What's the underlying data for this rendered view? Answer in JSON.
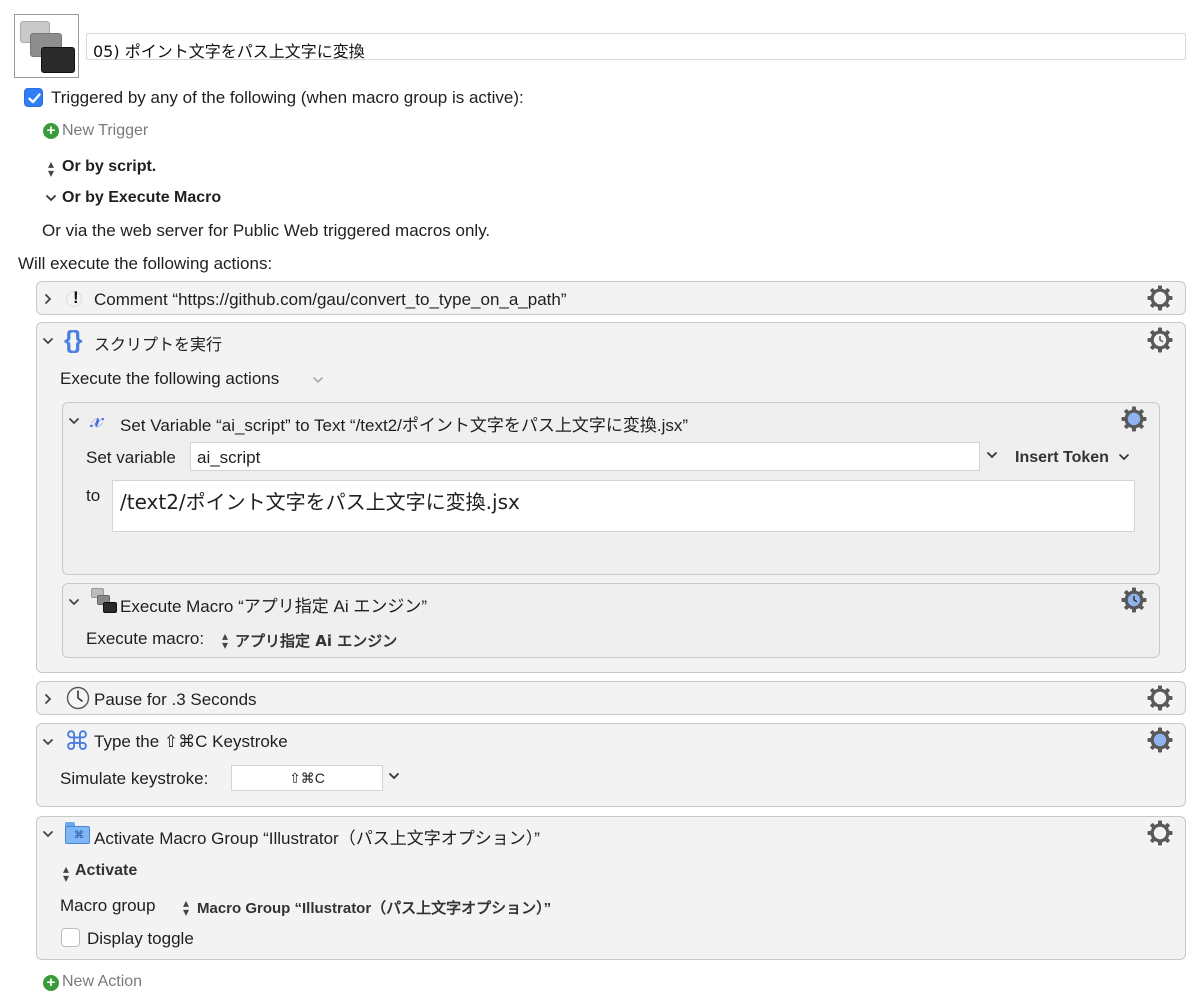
{
  "macro": {
    "name": "05) ポイント文字をパス上文字に変換"
  },
  "triggers": {
    "checkbox_label": "Triggered by any of the following (when macro group is active):",
    "new_trigger": "New Trigger",
    "or_by_script": "Or by script.",
    "or_by_execute_macro": "Or by Execute Macro",
    "web_server_note": "Or via the web server for Public Web triggered macros only."
  },
  "actions_heading": "Will execute the following actions:",
  "actions": {
    "comment": {
      "title": "Comment “https://github.com/gau/convert_to_type_on_a_path”"
    },
    "script": {
      "title": "スクリプトを実行",
      "execute_label": "Execute the following actions",
      "set_variable": {
        "title": "Set Variable “ai_script” to Text “/text2/ポイント文字をパス上文字に変換.jsx”",
        "set_variable_label": "Set variable",
        "variable_value": "ai_script",
        "insert_token": "Insert Token",
        "to_label": "to",
        "text_value": "/text2/ポイント文字をパス上文字に変換.jsx"
      },
      "execute_macro": {
        "title": "Execute Macro “アプリ指定 Ai エンジン”",
        "label": "Execute macro:",
        "value": "アプリ指定 Ai エンジン"
      }
    },
    "pause": {
      "title": "Pause for .3 Seconds"
    },
    "keystroke": {
      "title": "Type the ⇧⌘C Keystroke",
      "label": "Simulate keystroke:",
      "value": "⇧⌘C"
    },
    "activate_group": {
      "title": "Activate Macro Group “Illustrator（パス上文字オプション）”",
      "mode": "Activate",
      "group_label": "Macro group",
      "group_value": "Macro Group “Illustrator（パス上文字オプション）”",
      "display_toggle": "Display toggle"
    }
  },
  "new_action": "New Action",
  "colors": {
    "accent": "#2f7ef6",
    "green": "#3a9b3a",
    "panel": "#f3f3f3",
    "border": "#c8c8c8",
    "gear": "#555555"
  }
}
